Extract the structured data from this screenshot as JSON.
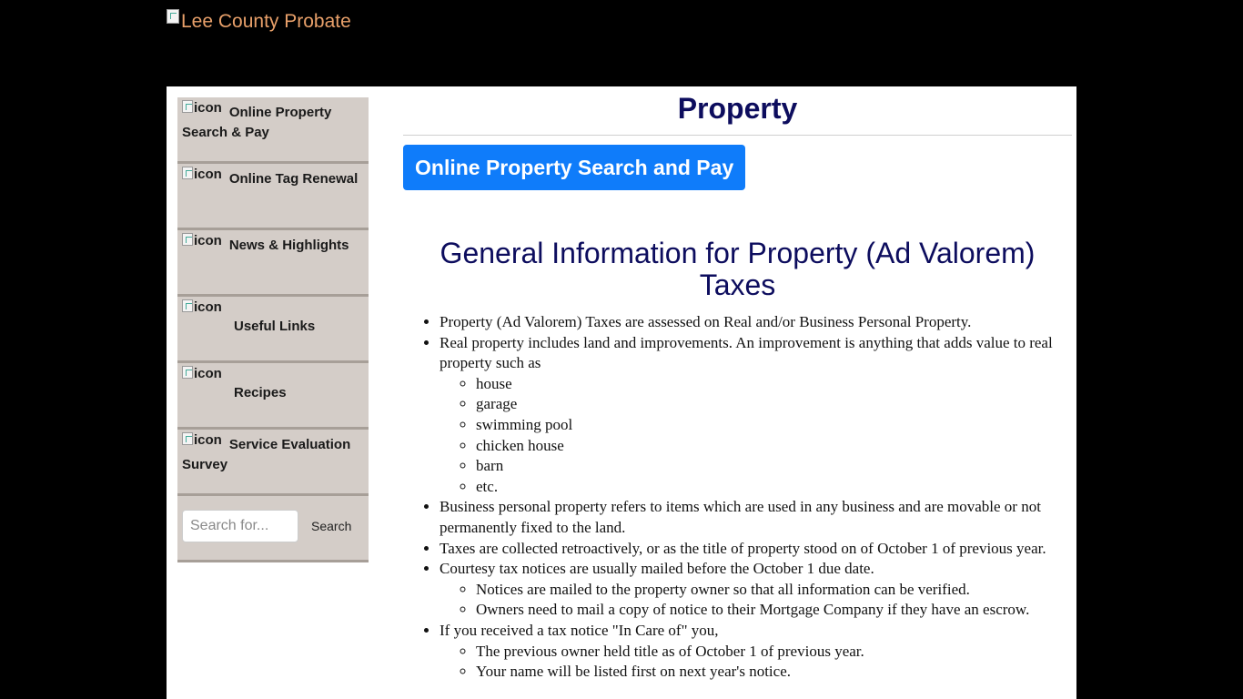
{
  "header": {
    "logo_alt": "Lee County Probate"
  },
  "sidebar": {
    "icon_alt": "icon",
    "items": [
      {
        "label": "Online Property Search & Pay"
      },
      {
        "label": "Online Tag Renewal"
      },
      {
        "label": "News & Highlights"
      },
      {
        "label": "Useful Links"
      },
      {
        "label": "Recipes"
      },
      {
        "label": "Service Evaluation Survey"
      }
    ],
    "search": {
      "placeholder": "Search for...",
      "button_label": "Search"
    }
  },
  "main": {
    "title": "Property",
    "cta_label": "Online Property Search and Pay",
    "section_title": "General Information for Property (Ad Valorem) Taxes",
    "bullets": [
      {
        "text": "Property (Ad Valorem) Taxes are assessed on Real and/or Business Personal Property."
      },
      {
        "text": "Real property includes land and improvements. An improvement is anything that adds value to real property such as",
        "sub": [
          "house",
          "garage",
          "swimming pool",
          "chicken house",
          "barn",
          "etc."
        ]
      },
      {
        "text": "Business personal property refers to items which are used in any business and are movable or not permanently fixed to the land."
      },
      {
        "text": "Taxes are collected retroactively, or as the title of property stood on of October 1 of previous year."
      },
      {
        "text": "Courtesy tax notices are usually mailed before the October 1 due date.",
        "sub": [
          "Notices are mailed to the property owner so that all information can be verified.",
          "Owners need to mail a copy of notice to their Mortgage Company if they have an escrow."
        ]
      },
      {
        "text": "If you received a tax notice \"In Care of\" you,",
        "sub": [
          "The previous owner held title as of October 1 of previous year.",
          "Your name will be listed first on next year's notice."
        ]
      }
    ]
  }
}
